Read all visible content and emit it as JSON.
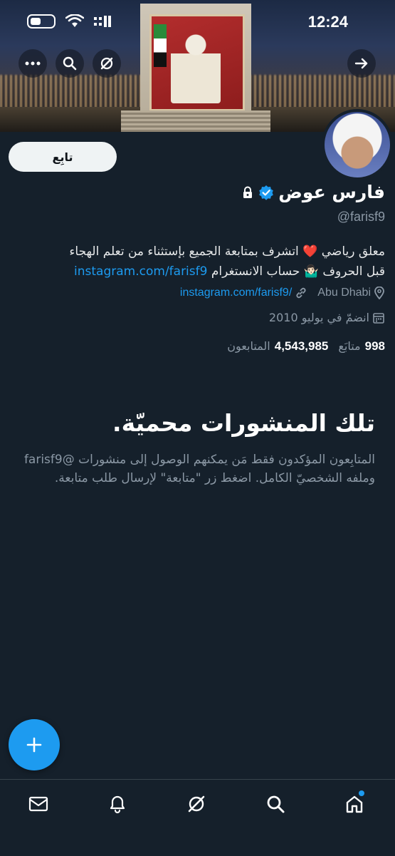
{
  "status_bar": {
    "time": "12:24"
  },
  "top_actions": {
    "more_icon": "more-icon",
    "search_icon": "search-icon",
    "grok_icon": "grok-icon",
    "back_icon": "arrow-right-icon"
  },
  "profile": {
    "display_name": "فارس عوض",
    "handle": "@farisf9",
    "follow_label": "تابِع",
    "bio_line1": "معلق رياضي ❤️ اتشرف بمتابعة الجميع بإستثناء من تعلم الهجاء",
    "bio_line2_text": "قبل الحروف 🤷🏻‍♂️ حساب الانستغرام",
    "bio_line2_link": "instagram.com/farisf9",
    "location": "Abu Dhabi",
    "website": "instagram.com/farisf9/",
    "joined": "انضمّ في يوليو 2010",
    "following_count": "998",
    "following_label": "متابَع",
    "followers_count": "4,543,985",
    "followers_label": "المتابعون"
  },
  "protected": {
    "title": "تلك المنشورات محميّة.",
    "body": "المتابِعون المؤكدون فقط مَن يمكنهم الوصول إلى منشورات @farisf9 وملفه الشخصيّ الكامل. اضغط زر \"متابعة\" لإرسال طلب متابعة."
  },
  "colors": {
    "background": "#15202b",
    "accent": "#1d9bf0",
    "secondary_text": "#8b98a5"
  },
  "bottom_nav": [
    "mail-icon",
    "bell-icon",
    "grok-icon",
    "search-icon",
    "home-icon"
  ]
}
